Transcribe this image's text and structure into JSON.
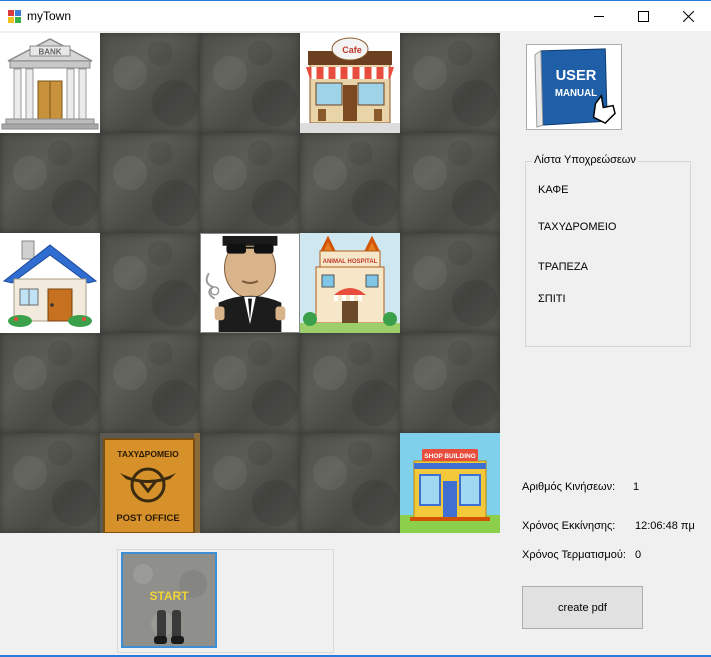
{
  "window": {
    "title": "myTown"
  },
  "icons": {
    "minimize": "minimize-icon",
    "maximize": "maximize-icon",
    "close": "close-icon"
  },
  "tasks": {
    "legend": "Λίστα Υποχρεώσεων",
    "items": [
      "ΚΑΦΕ",
      "ΤΑΧΥΔΡΟΜΕΙΟ",
      "ΤΡΑΠΕΖΑ",
      "ΣΠΙΤΙ"
    ]
  },
  "stats": {
    "moves_label": "Αριθμός Κινήσεων:",
    "moves_value": "1",
    "start_label": "Χρόνος Εκκίνησης:",
    "start_value": "12:06:48 πμ",
    "end_label": "Χρόνος Τερματισμού:",
    "end_value": "0"
  },
  "buttons": {
    "create_pdf": "create pdf"
  },
  "tiles": {
    "bank_sign": "BANK",
    "cafe_sign": "Cafe",
    "hospital_sign": "ANIMAL HOSPITAL",
    "post_sign_top": "ΤΑΧΥΔΡΟΜΕΙΟ",
    "post_sign_bottom": "POST OFFICE",
    "shop_sign": "SHOP BUILDING",
    "manual_line1": "USER",
    "manual_line2": "MANUAL",
    "start_text": "START"
  }
}
